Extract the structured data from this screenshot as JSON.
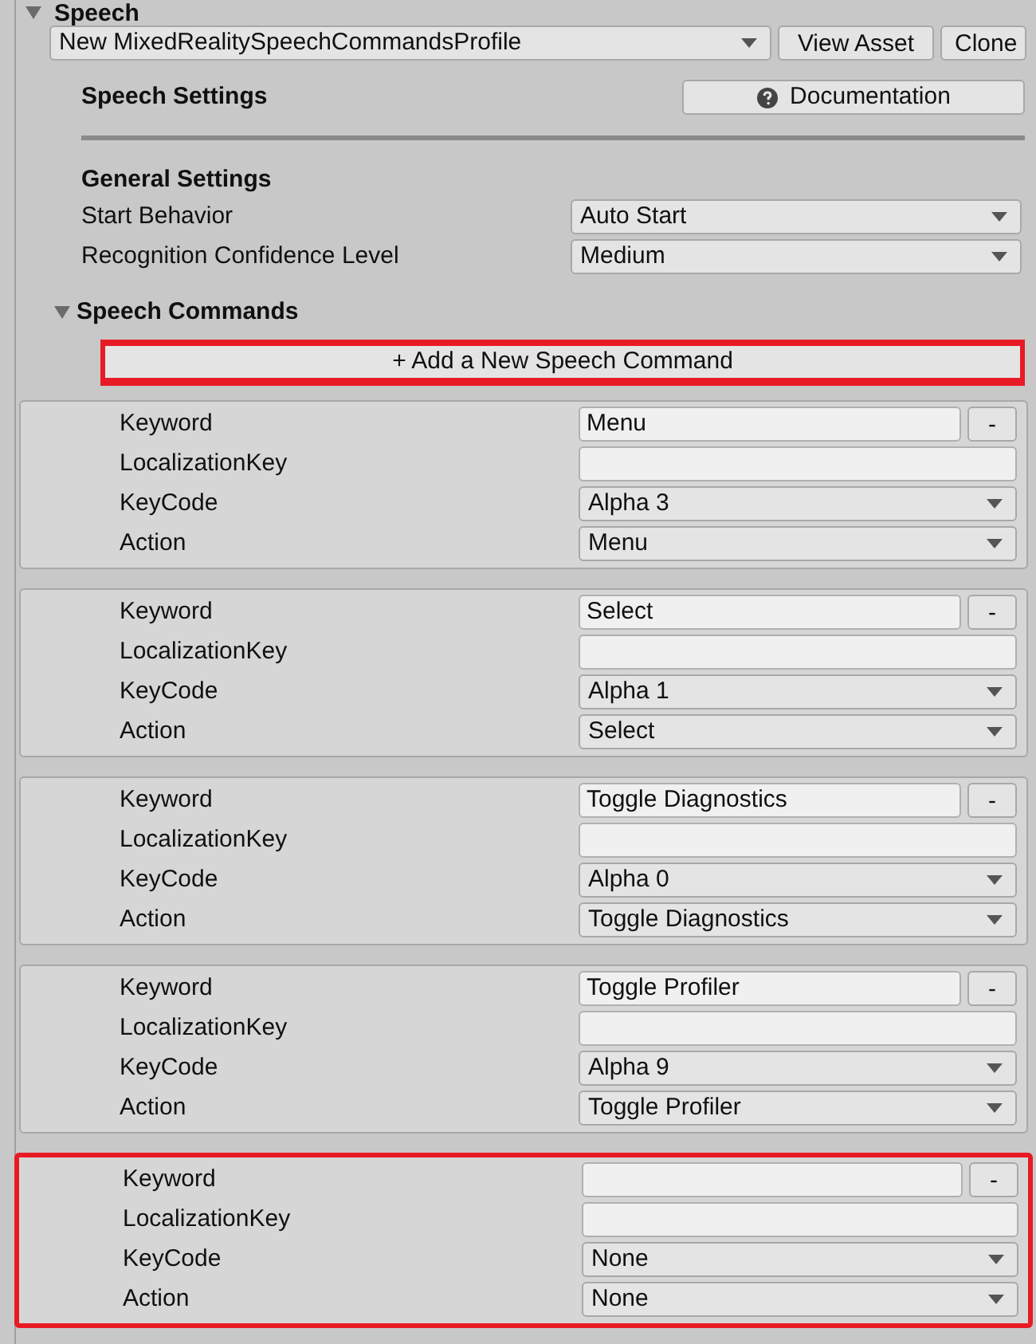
{
  "section": {
    "title": "Speech",
    "expanded": true
  },
  "profile": {
    "value": "New MixedRealitySpeechCommandsProfile",
    "buttons": [
      "View Asset",
      "Clone"
    ]
  },
  "header": {
    "title": "Speech Settings",
    "documentation_button": "Documentation"
  },
  "general_settings": {
    "title": "General Settings",
    "fields": [
      {
        "label": "Start Behavior",
        "value": "Auto Start"
      },
      {
        "label": "Recognition Confidence Level",
        "value": "Medium"
      }
    ]
  },
  "speech_commands": {
    "title": "Speech Commands",
    "expanded": true,
    "add_button": {
      "label": "+ Add a New Speech Command",
      "highlighted": true
    },
    "commands": [
      {
        "highlighted": false,
        "remove_button": "-",
        "fields": [
          {
            "kind": "text",
            "label": "Keyword",
            "value": "Menu"
          },
          {
            "kind": "text",
            "label": "LocalizationKey"
          },
          {
            "kind": "dropdown",
            "label": "KeyCode",
            "value": "Alpha 3"
          },
          {
            "kind": "dropdown",
            "label": "Action",
            "value": "Menu"
          }
        ]
      },
      {
        "highlighted": false,
        "remove_button": "-",
        "fields": [
          {
            "kind": "text",
            "label": "Keyword",
            "value": "Select"
          },
          {
            "kind": "text",
            "label": "LocalizationKey"
          },
          {
            "kind": "dropdown",
            "label": "KeyCode",
            "value": "Alpha 1"
          },
          {
            "kind": "dropdown",
            "label": "Action",
            "value": "Select"
          }
        ]
      },
      {
        "highlighted": false,
        "remove_button": "-",
        "fields": [
          {
            "kind": "text",
            "label": "Keyword",
            "value": "Toggle Diagnostics"
          },
          {
            "kind": "text",
            "label": "LocalizationKey"
          },
          {
            "kind": "dropdown",
            "label": "KeyCode",
            "value": "Alpha 0"
          },
          {
            "kind": "dropdown",
            "label": "Action",
            "value": "Toggle Diagnostics"
          }
        ]
      },
      {
        "highlighted": false,
        "remove_button": "-",
        "fields": [
          {
            "kind": "text",
            "label": "Keyword",
            "value": "Toggle Profiler"
          },
          {
            "kind": "text",
            "label": "LocalizationKey"
          },
          {
            "kind": "dropdown",
            "label": "KeyCode",
            "value": "Alpha 9"
          },
          {
            "kind": "dropdown",
            "label": "Action",
            "value": "Toggle Profiler"
          }
        ]
      },
      {
        "highlighted": true,
        "remove_button": "-",
        "fields": [
          {
            "kind": "text",
            "label": "Keyword"
          },
          {
            "kind": "text",
            "label": "LocalizationKey"
          },
          {
            "kind": "dropdown",
            "label": "KeyCode",
            "value": "None"
          },
          {
            "kind": "dropdown",
            "label": "Action",
            "value": "None"
          }
        ]
      }
    ]
  }
}
